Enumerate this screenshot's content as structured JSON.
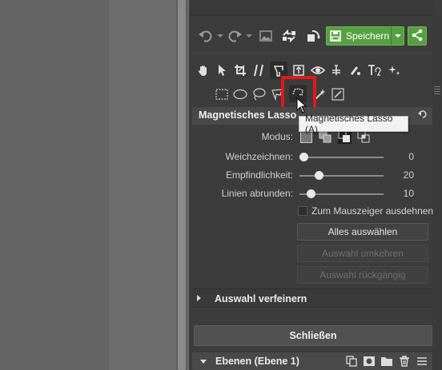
{
  "toolbar": {
    "undo_icon": "undo-icon",
    "redo_icon": "redo-icon",
    "save_label": "Speichern",
    "share_icon": "share-icon"
  },
  "tools": {
    "row1": [
      "hand-icon",
      "pointer-icon",
      "crop-icon",
      "straighten-icon",
      "magnetic-lasso-icon",
      "transform-icon",
      "eye-icon",
      "color-picker-icon",
      "paint-bucket-icon",
      "text-icon",
      "sparkle-icon"
    ],
    "row2": [
      "rect-select-icon",
      "ellipse-select-icon",
      "lasso-icon",
      "polygon-lasso-icon",
      "magnetic-lasso-active-icon",
      "magic-wand-icon",
      "edit-selection-icon"
    ]
  },
  "section": {
    "title": "Magnetisches Lasso",
    "tooltip": "Magnetisches Lasso (A)",
    "mode_label": "Modus:",
    "sliders": [
      {
        "label": "Weichzeichnen:",
        "value": "0",
        "fraction": 0.0
      },
      {
        "label": "Empfindlichkeit:",
        "value": "20",
        "fraction": 0.2
      },
      {
        "label": "Linien abrunden:",
        "value": "10",
        "fraction": 0.1
      }
    ],
    "checkbox_label": "Zum Mauszeiger ausdehnen",
    "checkbox_checked": false,
    "buttons": [
      {
        "label": "Alles auswählen",
        "enabled": true
      },
      {
        "label": "Auswahl umkehren",
        "enabled": false
      },
      {
        "label": "Auswahl rückgängig",
        "enabled": false
      }
    ]
  },
  "refine": {
    "title": "Auswahl verfeinern"
  },
  "close_label": "Schließen",
  "layers": {
    "title": "Ebenen (Ebene 1)"
  },
  "colors": {
    "accent": "#57a042",
    "highlight": "#e11919",
    "panel": "#3c3c3c"
  }
}
